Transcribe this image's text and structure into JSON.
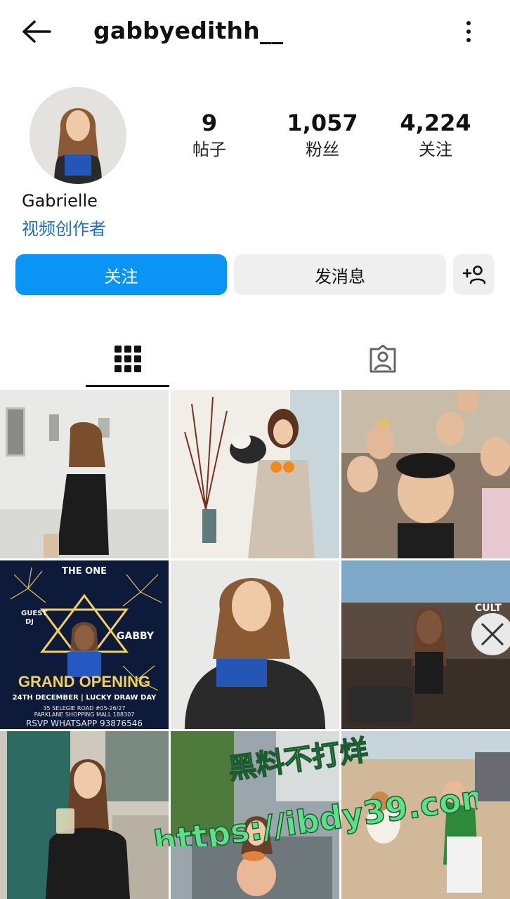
{
  "header": {
    "username": "gabbyedithh__",
    "back_icon": "arrow-left-icon",
    "more_icon": "more-vertical-icon"
  },
  "profile": {
    "display_name": "Gabrielle",
    "category": "视频创作者",
    "stats": [
      {
        "value": "9",
        "label": "帖子"
      },
      {
        "value": "1,057",
        "label": "粉丝"
      },
      {
        "value": "4,224",
        "label": "关注"
      }
    ]
  },
  "actions": {
    "follow_label": "关注",
    "message_label": "发消息",
    "add_user_icon": "add-user-icon"
  },
  "tabs": {
    "grid_icon": "grid-icon",
    "tagged_icon": "tagged-person-icon",
    "active": "grid"
  },
  "posts": {
    "poster_top": "THE ONE",
    "poster_guest": "GUEST",
    "poster_dj": "DJ",
    "poster_name": "GABBY",
    "poster_headline": "GRAND OPENING",
    "poster_date": "24TH DECEMBER | LUCKY DRAW DAY",
    "poster_address1": "35 SELEGIE ROAD #05-26/27",
    "poster_address2": "PARKLANE SHOPPING MALL 188307",
    "poster_rsvp": "RSVP WHATSAPP 93876546",
    "bar_sign": "CULT"
  },
  "watermark": {
    "line1": "黑料不打烊",
    "line2": "https://ibdy39.com"
  },
  "colors": {
    "accent": "#0a95f6",
    "link": "#1f6fb5",
    "button_grey": "#efefef",
    "watermark": "#5ee08a"
  }
}
